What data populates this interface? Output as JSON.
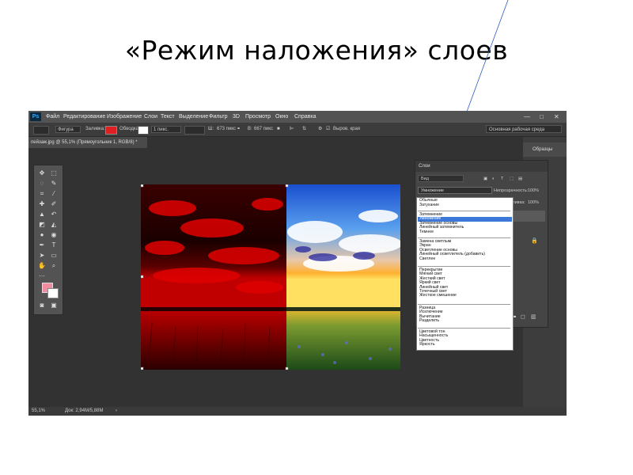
{
  "slide": {
    "title": "«Режим наложения» слоев"
  },
  "app": {
    "logo": "Ps",
    "menu": [
      "Файл",
      "Редактирование",
      "Изображение",
      "Слои",
      "Текст",
      "Выделение",
      "Фильтр",
      "3D",
      "Просмотр",
      "Окно",
      "Справка"
    ],
    "window_controls": {
      "minimize": "—",
      "maximize": "□",
      "close": "✕"
    },
    "options_bar": {
      "shape_mode": "Фигура",
      "fill_label": "Заливка:",
      "stroke_label": "Обводка:",
      "stroke_width": "1 пикс.",
      "w_label": "Ш:",
      "w_value": "673 пикс",
      "h_label": "В:",
      "h_value": "667 пикс",
      "align_edges": "Выров. края",
      "workspace": "Основная рабочая среда"
    },
    "doc_tab": "пейзаж.jpg @ 55,1% (Прямоугольник 1, RGB/8) *",
    "panels": {
      "swatches_tab": "Образцы",
      "layers_tab": "Слои",
      "search_kind": "Вид",
      "blend_mode": "Умножение",
      "opacity_label": "Непрозрачность:",
      "opacity_value": "100%",
      "fill_label": "Заливка:",
      "fill_value": "100%"
    },
    "blend_menu": {
      "groups": [
        [
          "Обычные",
          "Затухание"
        ],
        [
          "Затемнение",
          "Умножение",
          "Затемнение основы",
          "Линейный затемнитель",
          "Темнее"
        ],
        [
          "Замена светлым",
          "Экран",
          "Осветление основы",
          "Линейный осветлитель (добавить)",
          "Светлее"
        ],
        [
          "Перекрытие",
          "Мягкий свет",
          "Жесткий свет",
          "Яркий свет",
          "Линейный свет",
          "Точечный свет",
          "Жесткое смешение"
        ],
        [
          "Разница",
          "Исключение",
          "Вычитание",
          "Разделить"
        ],
        [
          "Цветовой тон",
          "Насыщенность",
          "Цветность",
          "Яркость"
        ]
      ],
      "selected": "Умножение"
    },
    "status": {
      "zoom": "55,1%",
      "doc_size": "Док: 2,94M/5,88M",
      "arrow": "›"
    },
    "colors": {
      "foreground": "#f08ca0",
      "background": "#ffffff",
      "fill": "#e02020",
      "selection": "#3b78d8"
    }
  }
}
